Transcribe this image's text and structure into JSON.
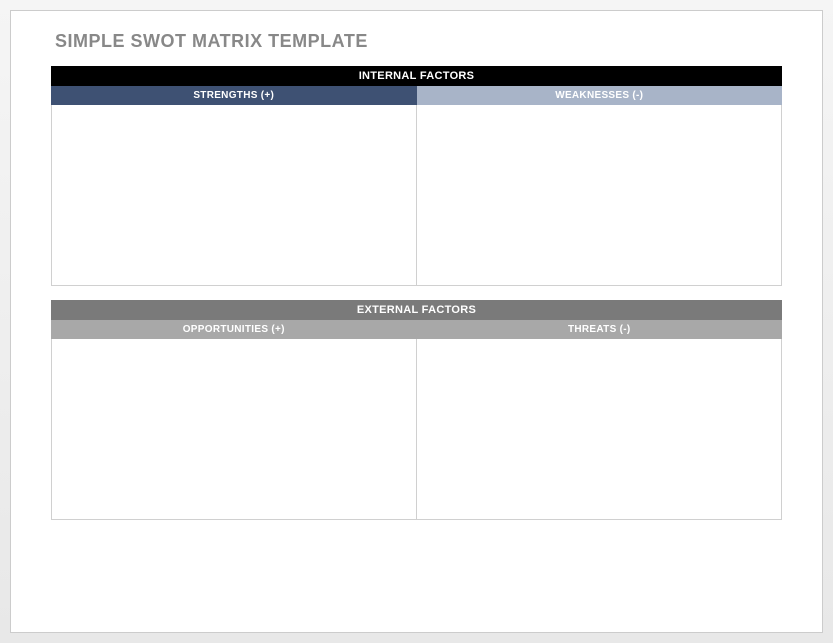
{
  "title": "SIMPLE SWOT MATRIX TEMPLATE",
  "sections": {
    "internal": {
      "header": "INTERNAL FACTORS",
      "left": {
        "label": "STRENGTHS (+)",
        "content": ""
      },
      "right": {
        "label": "WEAKNESSES (-)",
        "content": ""
      }
    },
    "external": {
      "header": "EXTERNAL FACTORS",
      "left": {
        "label": "OPPORTUNITIES (+)",
        "content": ""
      },
      "right": {
        "label": "THREATS (-)",
        "content": ""
      }
    }
  },
  "colors": {
    "internal_header": "#000000",
    "strengths_header": "#3e5173",
    "weaknesses_header": "#a8b4c8",
    "external_header": "#7a7a7a",
    "opportunities_header": "#a8a8a8",
    "threats_header": "#a8a8a8"
  }
}
